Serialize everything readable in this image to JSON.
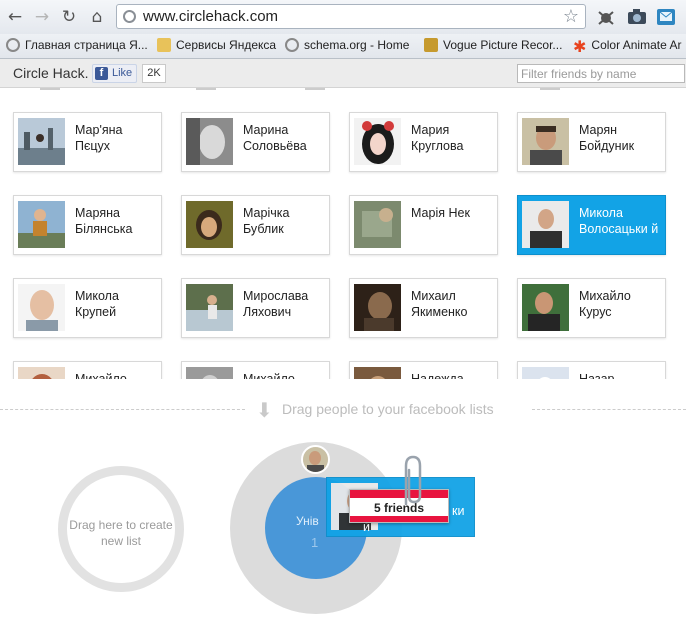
{
  "browser": {
    "url": "www.circlehack.com",
    "bookmarks": [
      {
        "label": "Главная страница Я...",
        "icon": "globe-icon"
      },
      {
        "label": "Сервисы Яндекса",
        "icon": "folder-icon"
      },
      {
        "label": "schema.org - Home",
        "icon": "globe-icon"
      },
      {
        "label": "Vogue Picture Recor...",
        "icon": "vogue-icon"
      },
      {
        "label": "Color Animate Ar",
        "icon": "asterisk-icon"
      }
    ]
  },
  "header": {
    "brand": "Circle Hack.",
    "like_label": "Like",
    "like_count": "2K",
    "filter_placeholder": "Filter friends by name"
  },
  "friends": [
    {
      "name": "Мар'яна Пєцух",
      "selected": false
    },
    {
      "name": "Марина Соловьёва",
      "selected": false
    },
    {
      "name": "Мария Круглова",
      "selected": false
    },
    {
      "name": "Марян Бойдуник",
      "selected": false
    },
    {
      "name": "Маряна Білянська",
      "selected": false
    },
    {
      "name": "Марічка Бублик",
      "selected": false
    },
    {
      "name": "Марія Нек",
      "selected": false
    },
    {
      "name": "Микола Волосацьки й",
      "selected": true
    },
    {
      "name": "Микола Крупей",
      "selected": false
    },
    {
      "name": "Мирослава Ляхович",
      "selected": false
    },
    {
      "name": "Михаил Якименко",
      "selected": false
    },
    {
      "name": "Михайло Курус",
      "selected": false
    },
    {
      "name": "Михайло",
      "selected": false
    },
    {
      "name": "Михайло",
      "selected": false
    },
    {
      "name": "Надежда",
      "selected": false
    },
    {
      "name": "Назар",
      "selected": false
    }
  ],
  "dropzone": {
    "hint": "Drag people to your facebook lists",
    "new_list_label": "Drag here to create new list",
    "list_name": "Унів",
    "list_count": "1",
    "drag_card_tail": "ки",
    "drag_card_tail2": "й",
    "drag_tag": "5 friends"
  },
  "colors": {
    "selected_card": "#12a3e6",
    "list_core": "#4997d8",
    "tag_band": "#e8143f"
  }
}
